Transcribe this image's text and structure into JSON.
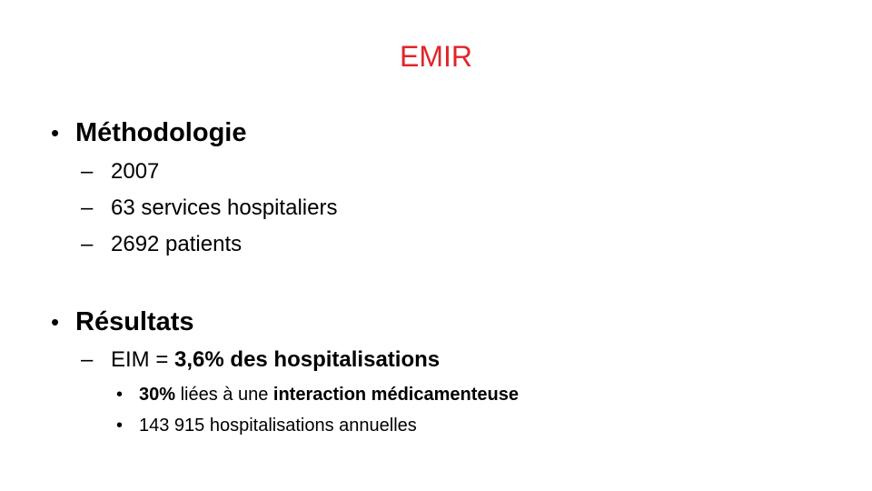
{
  "slide": {
    "title": "EMIR",
    "title_color": "#e0262b",
    "sections": [
      {
        "heading": "Méthodologie",
        "items": [
          "2007",
          "63 services hospitaliers",
          "2692 patients"
        ]
      },
      {
        "heading": "Résultats",
        "items": [
          {
            "prefix": "EIM = ",
            "bold": "3,6% des hospitalisations",
            "subitems": [
              {
                "bold_start": "30%",
                "middle": " liées à une ",
                "bold_end": "interaction médicamenteuse"
              },
              {
                "text": "143 915 hospitalisations annuelles"
              }
            ]
          }
        ]
      }
    ],
    "bullet_char": "•",
    "dash_char": "–"
  }
}
